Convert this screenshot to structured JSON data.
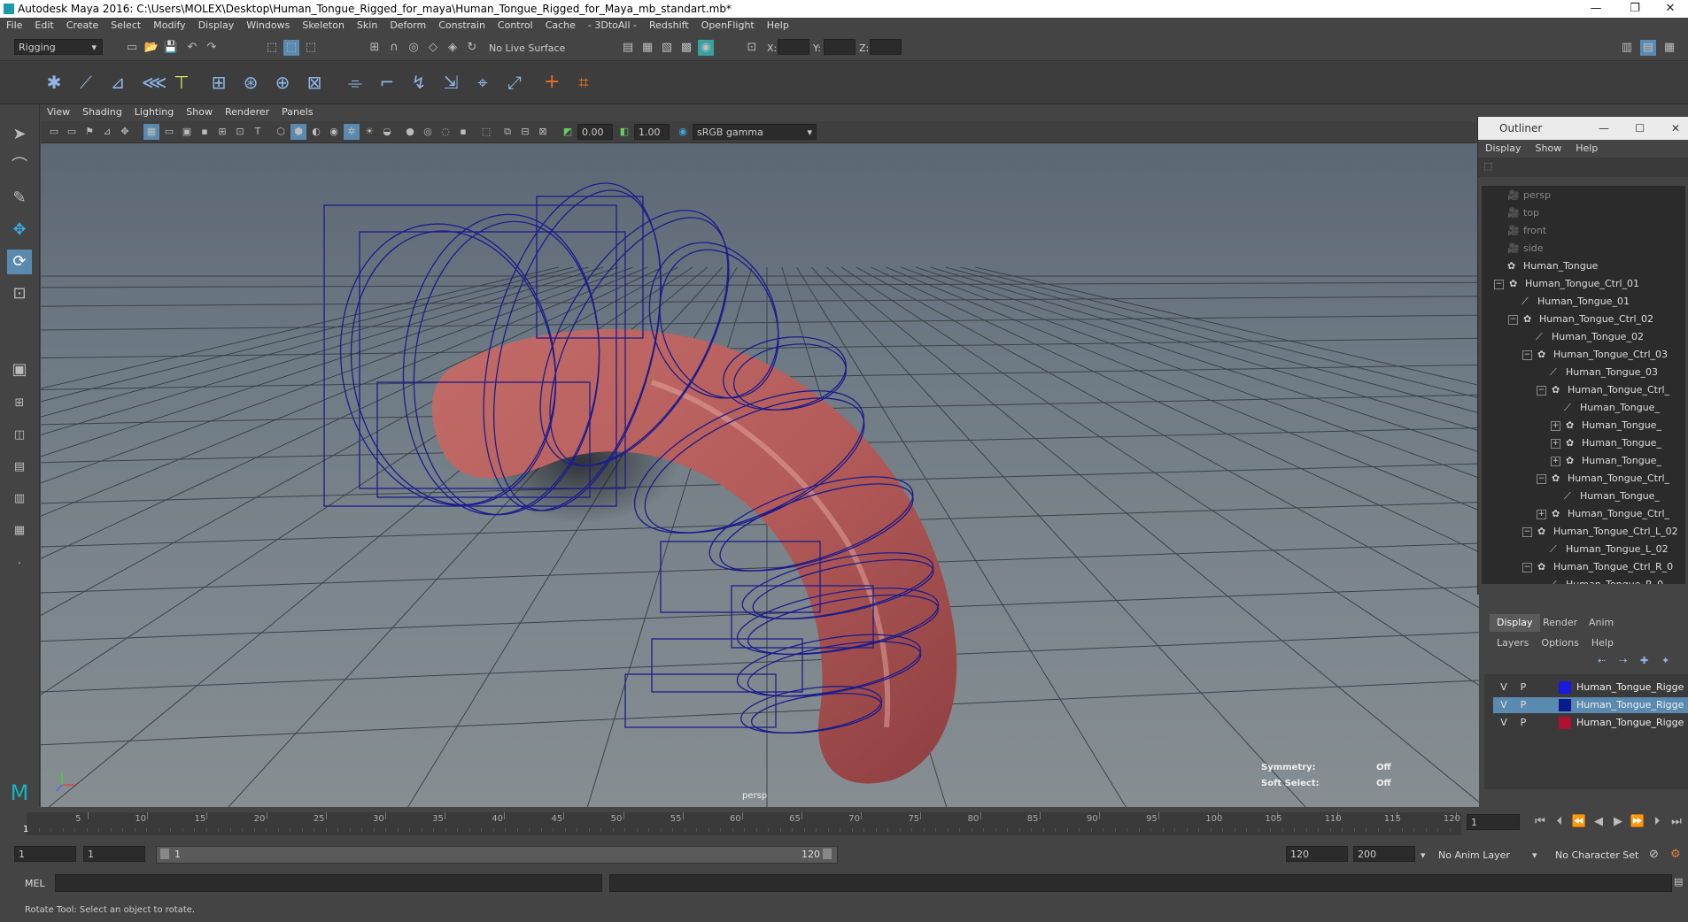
{
  "window": {
    "title": "Autodesk Maya 2016: C:\\Users\\MOLEX\\Desktop\\Human_Tongue_Rigged_for_maya\\Human_Tongue_Rigged_for_Maya_mb_standart.mb*"
  },
  "menubar": [
    "File",
    "Edit",
    "Create",
    "Select",
    "Modify",
    "Display",
    "Windows",
    "Skeleton",
    "Skin",
    "Deform",
    "Constrain",
    "Control",
    "Cache",
    "- 3DtoAll -",
    "Redshift",
    "OpenFlight",
    "Help"
  ],
  "toolbar": {
    "mode": "Rigging",
    "live_surface": "No Live Surface",
    "x_label": "X:",
    "y_label": "Y:",
    "z_label": "Z:"
  },
  "viewport": {
    "menu": [
      "View",
      "Shading",
      "Lighting",
      "Show",
      "Renderer",
      "Panels"
    ],
    "exposure": "0.00",
    "gamma": "1.00",
    "color_space": "sRGB gamma",
    "camera": "persp",
    "hud": {
      "symmetry_label": "Symmetry:",
      "symmetry_value": "Off",
      "soft_select_label": "Soft Select:",
      "soft_select_value": "Off"
    }
  },
  "outliner": {
    "title": "Outliner",
    "menu": [
      "Display",
      "Show",
      "Help"
    ],
    "rows": [
      {
        "label": "persp",
        "indent": 0,
        "type": "cam",
        "exp": ""
      },
      {
        "label": "top",
        "indent": 0,
        "type": "cam",
        "exp": ""
      },
      {
        "label": "front",
        "indent": 0,
        "type": "cam",
        "exp": ""
      },
      {
        "label": "side",
        "indent": 0,
        "type": "cam",
        "exp": ""
      },
      {
        "label": "Human_Tongue",
        "indent": 0,
        "type": "ctrl",
        "exp": ""
      },
      {
        "label": "Human_Tongue_Ctrl_01",
        "indent": 0,
        "type": "ctrl",
        "exp": "−"
      },
      {
        "label": "Human_Tongue_01",
        "indent": 1,
        "type": "joint",
        "exp": ""
      },
      {
        "label": "Human_Tongue_Ctrl_02",
        "indent": 1,
        "type": "ctrl",
        "exp": "−"
      },
      {
        "label": "Human_Tongue_02",
        "indent": 2,
        "type": "joint",
        "exp": ""
      },
      {
        "label": "Human_Tongue_Ctrl_03",
        "indent": 2,
        "type": "ctrl",
        "exp": "−"
      },
      {
        "label": "Human_Tongue_03",
        "indent": 3,
        "type": "joint",
        "exp": ""
      },
      {
        "label": "Human_Tongue_Ctrl_",
        "indent": 3,
        "type": "ctrl",
        "exp": "−"
      },
      {
        "label": "Human_Tongue_",
        "indent": 4,
        "type": "joint",
        "exp": ""
      },
      {
        "label": "Human_Tongue_",
        "indent": 4,
        "type": "ctrl",
        "exp": "+"
      },
      {
        "label": "Human_Tongue_",
        "indent": 4,
        "type": "ctrl",
        "exp": "+"
      },
      {
        "label": "Human_Tongue_",
        "indent": 4,
        "type": "ctrl",
        "exp": "+"
      },
      {
        "label": "Human_Tongue_Ctrl_",
        "indent": 3,
        "type": "ctrl",
        "exp": "−"
      },
      {
        "label": "Human_Tongue_",
        "indent": 4,
        "type": "joint",
        "exp": ""
      },
      {
        "label": "Human_Tongue_Ctrl_",
        "indent": 3,
        "type": "ctrl",
        "exp": "+"
      },
      {
        "label": "Human_Tongue_Ctrl_L_02",
        "indent": 2,
        "type": "ctrl",
        "exp": "−"
      },
      {
        "label": "Human_Tongue_L_02",
        "indent": 3,
        "type": "joint",
        "exp": ""
      },
      {
        "label": "Human_Tongue_Ctrl_R_0",
        "indent": 2,
        "type": "ctrl",
        "exp": "−"
      },
      {
        "label": "Human_Tongue_R_0",
        "indent": 3,
        "type": "joint",
        "exp": ""
      }
    ]
  },
  "layers": {
    "tabs": [
      "Display",
      "Render",
      "Anim"
    ],
    "menu": [
      "Layers",
      "Options",
      "Help"
    ],
    "rows": [
      {
        "v": "V",
        "p": "P",
        "color": "#1a1adc",
        "name": "Human_Tongue_Rigge",
        "selected": false
      },
      {
        "v": "V",
        "p": "P",
        "color": "#0b1a8c",
        "name": "Human_Tongue_Rigge",
        "selected": true
      },
      {
        "v": "V",
        "p": "P",
        "color": "#b01030",
        "name": "Human_Tongue_Rigge",
        "selected": false
      }
    ]
  },
  "timeline": {
    "ticks": [
      "5",
      "10",
      "15",
      "20",
      "25",
      "30",
      "35",
      "40",
      "45",
      "50",
      "55",
      "60",
      "65",
      "70",
      "75",
      "80",
      "85",
      "90",
      "95",
      "100",
      "105",
      "110",
      "115",
      "120"
    ],
    "start_marker": "1",
    "current_frame": "1"
  },
  "range": {
    "start": "1",
    "start2": "1",
    "slider_start": "1",
    "slider_end": "120",
    "end": "120",
    "end2": "200",
    "anim_layer": "No Anim Layer",
    "char_set": "No Character Set"
  },
  "command": {
    "label": "MEL"
  },
  "status": {
    "text": "Rotate Tool: Select an object to rotate."
  }
}
